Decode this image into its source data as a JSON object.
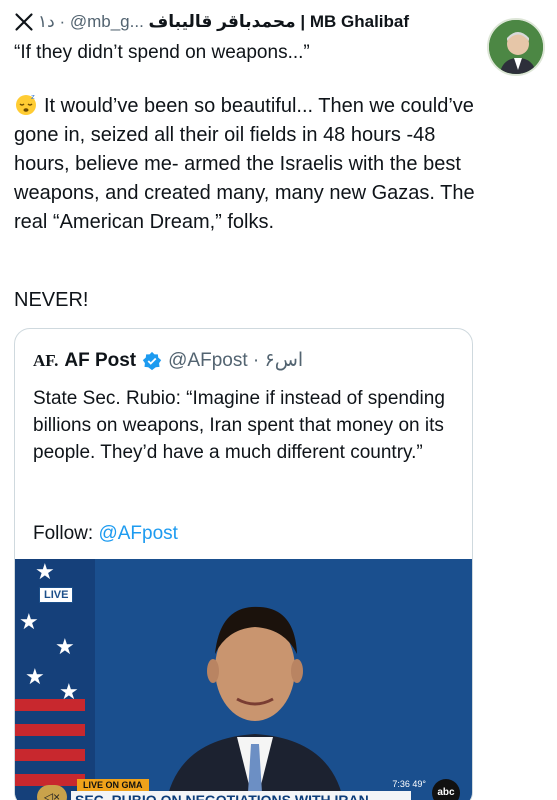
{
  "post": {
    "handle_line": "محمدباقر قالیباف | MB Ghalibaf ...@mb_g · ۱د",
    "display_name": "محمدباقر قالیباف | MB Ghalibaf",
    "handle": "@mb_g...",
    "time": "۱د",
    "quote": "“If they didn’t spend on weapons...”",
    "body": "It would’ve been so beautiful... Then we could’ve gone in, seized all their oil fields in 48 hours -48 hours, believe me- armed the Israelis with the best weapons, and created many, many new Gazas. The real “American Dream,” folks.",
    "closing": "NEVER!",
    "emoji": "sleeping-face-icon"
  },
  "quoted": {
    "logo": "AF.",
    "name": "AF Post",
    "handle": "@AFpost",
    "time": "۶اس",
    "handle_time": "@AFpost · ۶اس",
    "text": "State Sec. Rubio: “Imagine if instead of spending billions on weapons, Iran spent that money on its people. They’d have a much different country.”",
    "follow_label": "Follow:",
    "follow_link": "@AFpost",
    "video": {
      "live": "LIVE",
      "show_label": "LIVE ON GMA",
      "headline": "SEC. RUBIO ON NEGOTIATIONS WITH IRAN",
      "time": "7:36  49°",
      "network": "abc",
      "mute_icon": "◁×"
    }
  },
  "colors": {
    "link": "#1d9bf0",
    "muted": "#536471",
    "video_bg": "#1c4f8a",
    "gma_orange": "#f0a21a"
  }
}
